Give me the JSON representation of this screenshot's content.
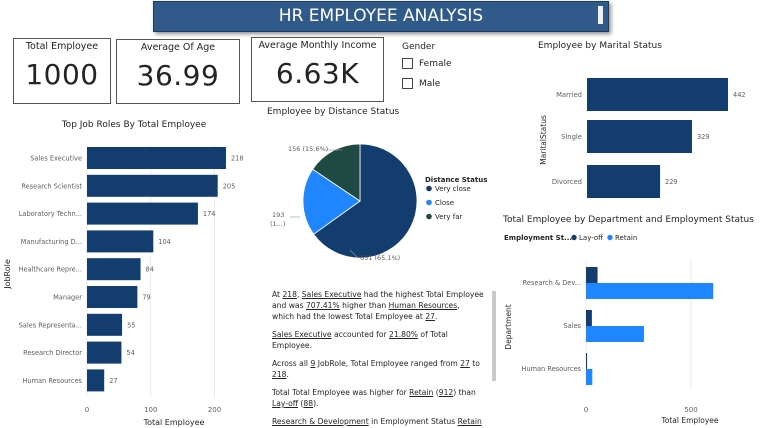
{
  "header": {
    "title": "HR EMPLOYEE ANALYSIS"
  },
  "kpis": {
    "total_employee": {
      "label": "Total Employee",
      "value": "1000"
    },
    "average_age": {
      "label": "Average Of Age",
      "value": "36.99"
    },
    "average_income": {
      "label": "Average Monthly Income",
      "value": "6.63K"
    }
  },
  "gender_slicer": {
    "title": "Gender",
    "options": [
      "Female",
      "Male"
    ]
  },
  "colors": {
    "dark_blue": "#123d6e",
    "mid_blue": "#1f86ff",
    "very_far": "#1e4a43",
    "header_bg": "#2f5a8a"
  },
  "job_roles_chart": {
    "title": "Top Job Roles By Total Employee",
    "xlabel": "Total Employee",
    "ylabel": "JobRole",
    "categories": [
      "Sales Executive",
      "Research Scientist",
      "Laboratory Techn...",
      "Manufacturing D...",
      "Healthcare Repre...",
      "Manager",
      "Sales Representa...",
      "Research Director",
      "Human Resources"
    ],
    "values": [
      218,
      205,
      174,
      104,
      84,
      79,
      55,
      54,
      27
    ],
    "ticks": [
      "0",
      "100",
      "200"
    ]
  },
  "distance_chart": {
    "title": "Employee by Distance Status",
    "legend_title": "Distance Status",
    "labels": [
      "Very close",
      "Close",
      "Very far"
    ],
    "values": [
      651,
      193,
      156
    ],
    "slice_labels": [
      "651 (65.1%)",
      "193",
      "(1...)",
      "156 (15.6%)"
    ]
  },
  "marital_chart": {
    "title": "Employee by Marital Status",
    "ylabel": "MaritalStatus",
    "categories": [
      "Married",
      "Single",
      "Divorced"
    ],
    "values": [
      442,
      329,
      229
    ]
  },
  "dept_chart": {
    "title": "Total Employee by Department and Employment Status",
    "legend_title": "Employment St...",
    "legend": [
      "Lay-off",
      "Retain"
    ],
    "xlabel": "Total Employee",
    "ylabel": "Department",
    "categories": [
      "Research & Dev...",
      "Sales",
      "Human Resources"
    ],
    "ticks": [
      "0",
      "500"
    ]
  },
  "chart_data": [
    {
      "type": "bar",
      "title": "Top Job Roles By Total Employee",
      "xlabel": "Total Employee",
      "ylabel": "JobRole",
      "categories": [
        "Sales Executive",
        "Research Scientist",
        "Laboratory Techn...",
        "Manufacturing D...",
        "Healthcare Repre...",
        "Manager",
        "Sales Representa...",
        "Research Director",
        "Human Resources"
      ],
      "values": [
        218,
        205,
        174,
        104,
        84,
        79,
        55,
        54,
        27
      ],
      "xlim": [
        0,
        240
      ]
    },
    {
      "type": "pie",
      "title": "Employee by Distance Status",
      "categories": [
        "Very close",
        "Close",
        "Very far"
      ],
      "values": [
        651,
        193,
        156
      ]
    },
    {
      "type": "bar",
      "title": "Employee by Marital Status",
      "ylabel": "MaritalStatus",
      "categories": [
        "Married",
        "Single",
        "Divorced"
      ],
      "values": [
        442,
        329,
        229
      ]
    },
    {
      "type": "bar",
      "title": "Total Employee by Department and Employment Status",
      "xlabel": "Total Employee",
      "ylabel": "Department",
      "categories": [
        "Research & Dev...",
        "Sales",
        "Human Resources"
      ],
      "series": [
        {
          "name": "Lay-off",
          "values": [
            55,
            28,
            5
          ]
        },
        {
          "name": "Retain",
          "values": [
            606,
            276,
            30
          ]
        }
      ],
      "xlim": [
        0,
        720
      ]
    }
  ],
  "narrative": {
    "p1": {
      "a": "At ",
      "b": "218",
      "c": ", ",
      "d": "Sales Executive",
      "e": " had the highest Total Employee and was ",
      "f": "707.41%",
      "g": " higher than ",
      "h": "Human Resources",
      "i": ", which had the lowest Total Employee at ",
      "j": "27",
      "k": "."
    },
    "p2": {
      "a": "Sales Executive",
      "b": " accounted for ",
      "c": "21.80%",
      "d": " of Total Employee."
    },
    "p3": {
      "a": "Across all ",
      "b": "9",
      "c": " ",
      "d": "JobRole",
      "e": ", Total Employee ranged from ",
      "f": "27",
      "g": " to ",
      "h": "218",
      "i": "."
    },
    "p4": {
      "a": "Total Total Employee was higher for ",
      "b": "Retain",
      "c": " (",
      "d": "912",
      "e": ") than ",
      "f": "Lay-off",
      "g": " (",
      "h": "88",
      "i": ")."
    },
    "p5": {
      "a": "Research & Development",
      "b": " in Employment Status ",
      "c": "Retain"
    }
  }
}
